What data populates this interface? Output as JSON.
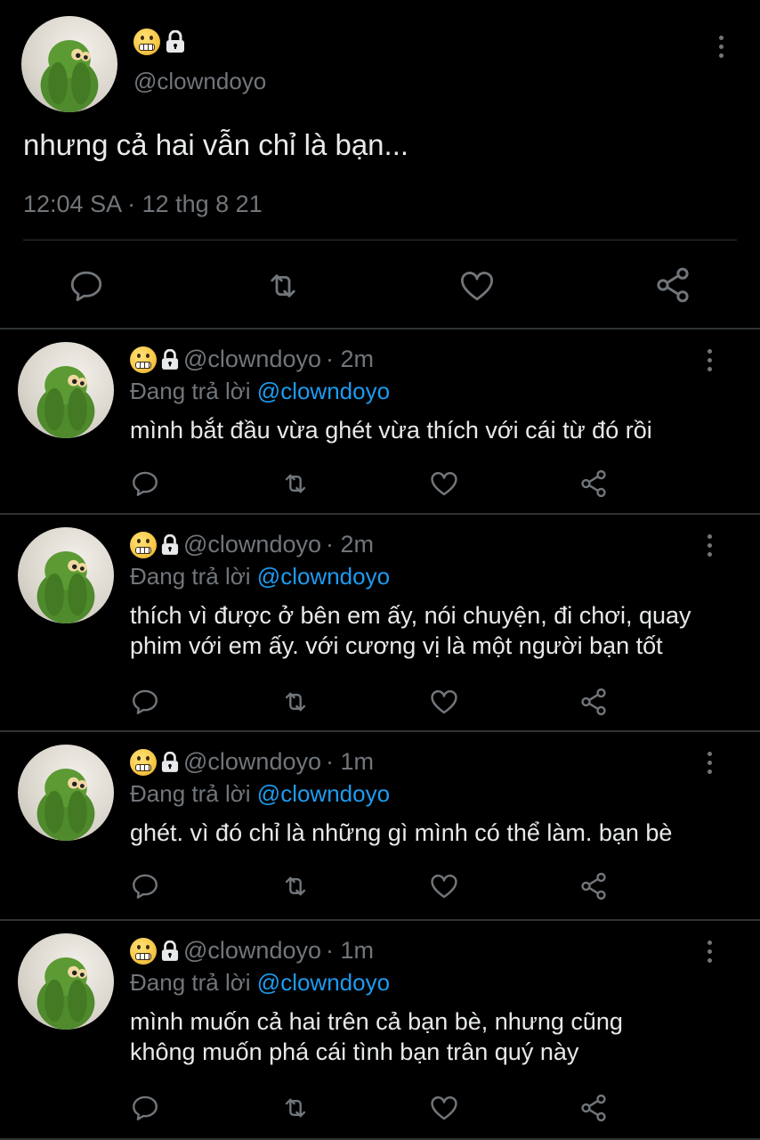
{
  "main_tweet": {
    "handle": "@clowndoyo",
    "text": "nhưng cả hai vẫn chỉ là bạn...",
    "timestamp": "12:04 SA · 12 thg 8 21",
    "icons": [
      "grimacing-emoji-icon",
      "lock-icon",
      "more-vertical-icon",
      "reply-icon",
      "retweet-icon",
      "like-icon",
      "share-icon"
    ]
  },
  "replies": [
    {
      "handle": "@clowndoyo",
      "time": "· 2m",
      "replying_prefix": "Đang trả lời",
      "replying_to": "@clowndoyo",
      "lines": [
        "mình bắt đầu vừa ghét vừa thích với cái từ đó rồi"
      ]
    },
    {
      "handle": "@clowndoyo",
      "time": "· 2m",
      "replying_prefix": "Đang trả lời",
      "replying_to": "@clowndoyo",
      "lines": [
        "thích vì được ở bên em ấy, nói chuyện, đi chơi, quay",
        "phim với em ấy. với cương vị là một người bạn tốt"
      ]
    },
    {
      "handle": "@clowndoyo",
      "time": "· 1m",
      "replying_prefix": "Đang trả lời",
      "replying_to": "@clowndoyo",
      "lines": [
        "ghét. vì đó chỉ là những gì mình có thể làm. bạn bè"
      ]
    },
    {
      "handle": "@clowndoyo",
      "time": "· 1m",
      "replying_prefix": "Đang trả lời",
      "replying_to": "@clowndoyo",
      "lines": [
        "mình muốn cả hai trên cả bạn bè, nhưng cũng",
        "không muốn phá cái tình bạn trân quý này"
      ]
    }
  ],
  "colors": {
    "background": "#000000",
    "text": "#e7e9ea",
    "secondary": "#71767b",
    "mention": "#1d9bf0",
    "divider": "#2f3336"
  }
}
